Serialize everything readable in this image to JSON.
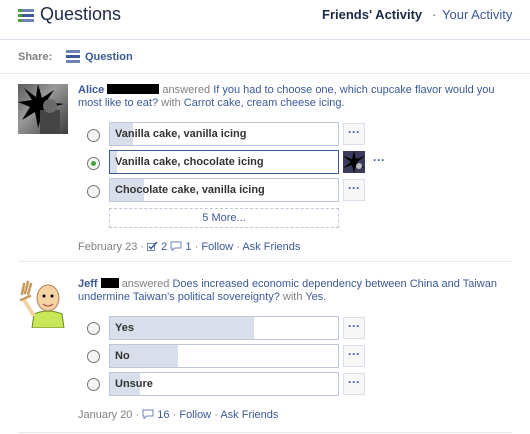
{
  "header": {
    "title": "Questions",
    "friends_activity": "Friends' Activity",
    "separator": "·",
    "your_activity": "Your Activity"
  },
  "share": {
    "label": "Share:",
    "question_link": "Question"
  },
  "stories": [
    {
      "actor": "Alice",
      "verb": "answered",
      "question": "If you had to choose one, which cupcake flavor would you most like to eat?",
      "answer_prefix": "with",
      "answer": "Carrot cake, cream cheese icing.",
      "options": [
        {
          "label": "Vanilla cake, vanilla icing",
          "fill": 0.1,
          "selected": false
        },
        {
          "label": "Vanilla cake, chocolate icing",
          "fill": 0.03,
          "selected": true
        },
        {
          "label": "Chocolate cake, vanilla icing",
          "fill": 0.15,
          "selected": false
        }
      ],
      "more_options": "5 More...",
      "more_button": "···",
      "date": "February 23",
      "dot": "·",
      "follows": "2",
      "comments": "1",
      "follow": "Follow",
      "ask_friends": "Ask Friends"
    },
    {
      "actor": "Jeff",
      "verb": "answered",
      "question": "Does increased economic dependency between China and Taiwan undermine Taiwan's political sovereignty?",
      "answer_prefix": "with",
      "answer": "Yes.",
      "options": [
        {
          "label": "Yes",
          "fill": 0.63,
          "selected": false
        },
        {
          "label": "No",
          "fill": 0.3,
          "selected": false
        },
        {
          "label": "Unsure",
          "fill": 0.13,
          "selected": false
        }
      ],
      "more_button": "···",
      "date": "January 20",
      "dot": "·",
      "comments": "16",
      "follow": "Follow",
      "ask_friends": "Ask Friends"
    }
  ],
  "colors": {
    "link": "#3b5998",
    "bar_fill": "#d8dfea",
    "radio_selected": "#3fa33b",
    "muted": "#808080"
  }
}
